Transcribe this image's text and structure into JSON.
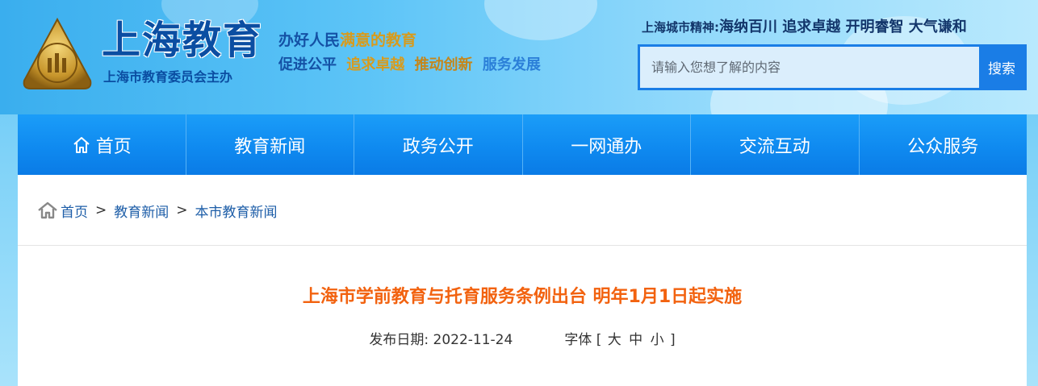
{
  "header": {
    "logo_title": "上海教育",
    "logo_subtitle": "上海市教育委员会主办",
    "slogan_line1_a": "办好人民",
    "slogan_line1_b": "满意的教育",
    "slogan_line2": [
      "促进公平",
      "追求卓越",
      "推动创新",
      "服务发展"
    ],
    "spirit_label": "上海城市精神:",
    "spirit_text": "海纳百川 追求卓越 开明睿智 大气谦和"
  },
  "search": {
    "placeholder": "请输入您想了解的内容",
    "button_label": "搜索"
  },
  "nav": {
    "items": [
      {
        "label": "首页",
        "icon": "home-icon"
      },
      {
        "label": "教育新闻"
      },
      {
        "label": "政务公开"
      },
      {
        "label": "一网通办"
      },
      {
        "label": "交流互动"
      },
      {
        "label": "公众服务"
      }
    ]
  },
  "breadcrumb": {
    "icon": "home-icon",
    "items": [
      "首页",
      "教育新闻",
      "本市教育新闻"
    ],
    "separator": ">"
  },
  "article": {
    "title": "上海市学前教育与托育服务条例出台 明年1月1日起实施",
    "date_label": "发布日期:",
    "date": "2022-11-24",
    "font_label": "字体",
    "font_open": "[",
    "font_sizes": [
      "大",
      "中",
      "小"
    ],
    "font_close": "]"
  },
  "colors": {
    "nav_bg": "#0f8af0",
    "title_orange": "#f2620f",
    "link_blue": "#1e5ea8",
    "brand_blue": "#0b4ea2"
  }
}
